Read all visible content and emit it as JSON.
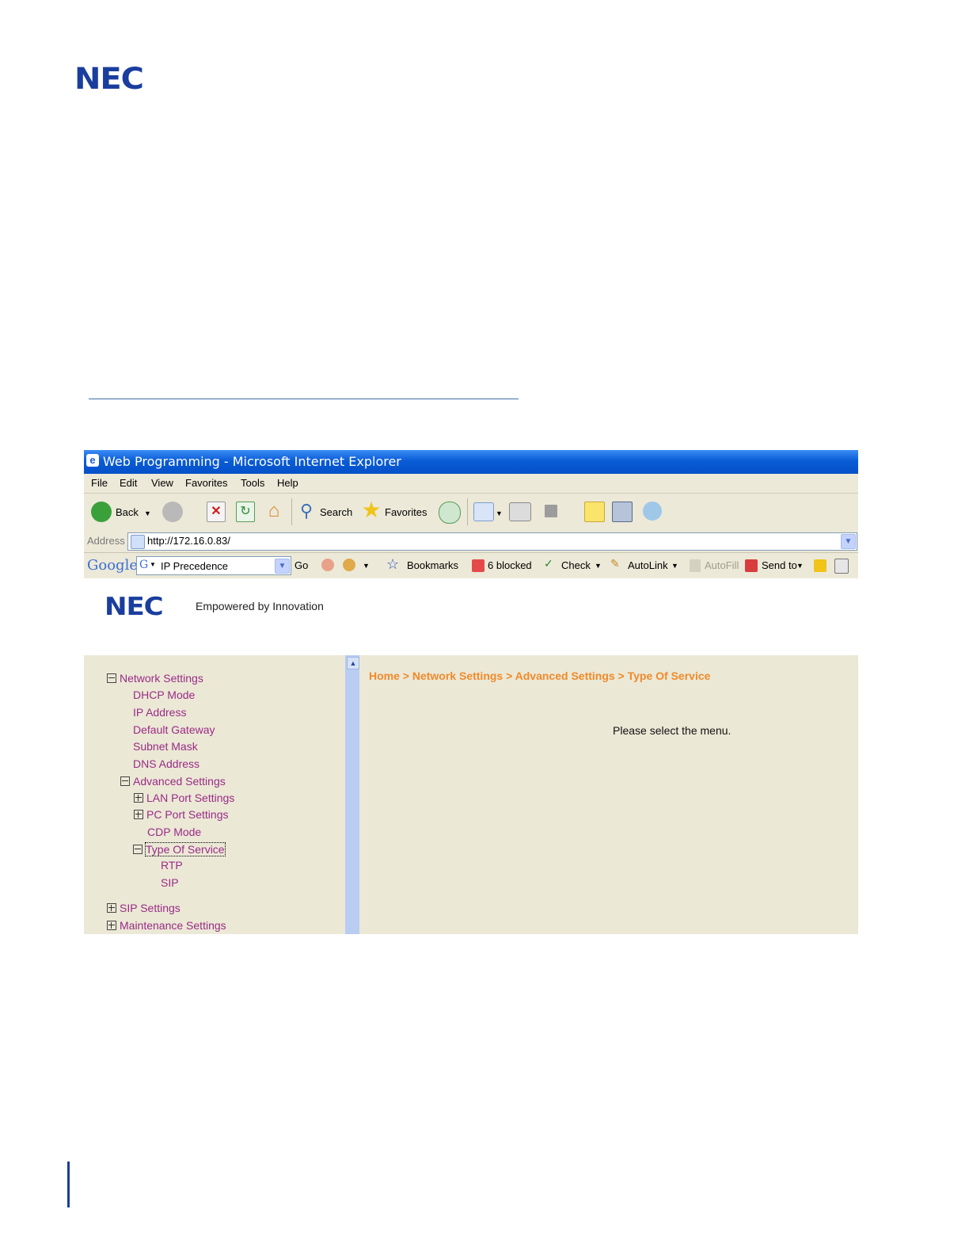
{
  "document": {
    "logo_text": "NEC"
  },
  "browser": {
    "title": "Web Programming - Microsoft Internet Explorer",
    "menu": [
      "File",
      "Edit",
      "View",
      "Favorites",
      "Tools",
      "Help"
    ],
    "toolbar": {
      "back_label": "Back",
      "search_label": "Search",
      "favorites_label": "Favorites"
    },
    "address": {
      "label": "Address",
      "url": "http://172.16.0.83/"
    },
    "google_bar": {
      "logo": "Google",
      "search_value": "IP Precedence",
      "go_label": "Go",
      "bookmarks_label": "Bookmarks",
      "blocked_label": "6 blocked",
      "check_label": "Check",
      "autolink_label": "AutoLink",
      "autofill_label": "AutoFill",
      "sendto_label": "Send to"
    }
  },
  "page": {
    "logo_text": "NEC",
    "tagline": "Empowered by Innovation",
    "breadcrumb": "Home > Network Settings > Advanced Settings > Type Of Service",
    "message": "Please select the menu.",
    "nav": {
      "network_settings": "Network Settings",
      "dhcp_mode": "DHCP Mode",
      "ip_address": "IP Address",
      "default_gateway": "Default Gateway",
      "subnet_mask": "Subnet Mask",
      "dns_address": "DNS Address",
      "advanced_settings": "Advanced Settings",
      "lan_port_settings": "LAN Port Settings",
      "pc_port_settings": "PC Port Settings",
      "cdp_mode": "CDP Mode",
      "type_of_service": "Type Of Service",
      "rtp": "RTP",
      "sip": "SIP",
      "sip_settings": "SIP Settings",
      "maintenance_settings": "Maintenance Settings"
    }
  },
  "colors": {
    "nec_blue": "#1a3e9e",
    "nav_link": "#9a2b86",
    "breadcrumb": "#f08a2a",
    "panel_bg": "#ebe8d6",
    "titlebar": "#0a5cd6"
  }
}
